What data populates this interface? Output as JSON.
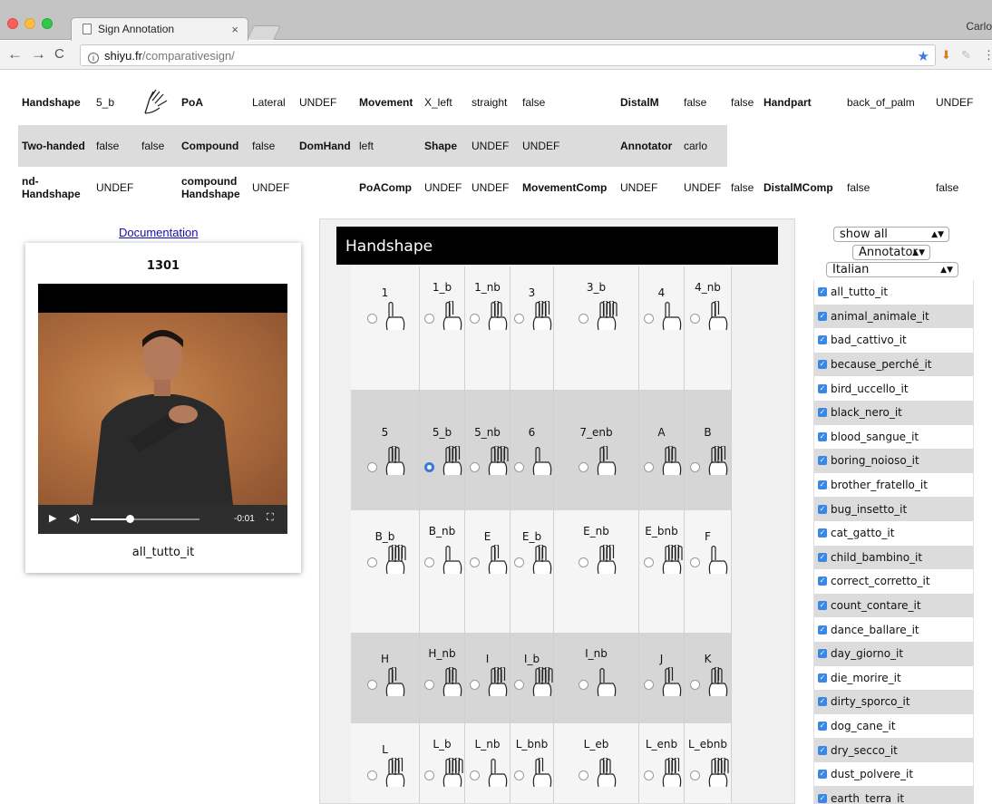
{
  "browser": {
    "tab_title": "Sign Annotation",
    "tab_close": "×",
    "url_host": "shiyu.fr",
    "url_path": "/comparativesign/",
    "profile": "Carlo"
  },
  "attributes": {
    "row1": [
      "Handshape",
      "5_b",
      "",
      "PoA",
      "Lateral",
      "UNDEF",
      "Movement",
      "X_left",
      "straight",
      "false",
      "DistalM",
      "false",
      "false",
      "Handpart",
      "back_of_palm",
      "UNDEF"
    ],
    "row2": [
      "Two-handed",
      "false",
      "false",
      "Compound",
      "false",
      "DomHand",
      "left",
      "Shape",
      "UNDEF",
      "UNDEF",
      "Annotator",
      "carlo"
    ],
    "row3": [
      "nd-Handshape",
      "UNDEF",
      "",
      "compound Handshape",
      "UNDEF",
      "",
      "PoAComp",
      "UNDEF",
      "UNDEF",
      "MovementComp",
      "UNDEF",
      "UNDEF",
      "false",
      "DistalMComp",
      "false",
      "false"
    ]
  },
  "video": {
    "documentation_link": "Documentation",
    "number": "1301",
    "time": "-0:01",
    "progress": 0.36,
    "caption": "all_tutto_it"
  },
  "handshape": {
    "title": "Handshape",
    "selected": "5_b",
    "rows": [
      [
        "1",
        "1_b",
        "1_nb",
        "3",
        "3_b",
        "4",
        "4_nb"
      ],
      [
        "5",
        "5_b",
        "5_nb",
        "6",
        "7_enb",
        "A",
        "B"
      ],
      [
        "B_b",
        "B_nb",
        "E",
        "E_b",
        "E_nb",
        "E_bnb",
        "F"
      ],
      [
        "H",
        "H_nb",
        "I",
        "I_b",
        "I_nb",
        "J",
        "K"
      ],
      [
        "L",
        "L_b",
        "L_nb",
        "L_bnb",
        "L_eb",
        "L_enb",
        "L_ebnb"
      ]
    ]
  },
  "filters": {
    "show": "show all",
    "annotator": "Annotator",
    "language": "Italian"
  },
  "signs": [
    "all_tutto_it",
    "animal_animale_it",
    "bad_cattivo_it",
    "because_perché_it",
    "bird_uccello_it",
    "black_nero_it",
    "blood_sangue_it",
    "boring_noioso_it",
    "brother_fratello_it",
    "bug_insetto_it",
    "cat_gatto_it",
    "child_bambino_it",
    "correct_corretto_it",
    "count_contare_it",
    "dance_ballare_it",
    "day_giorno_it",
    "die_morire_it",
    "dirty_sporco_it",
    "dog_cane_it",
    "dry_secco_it",
    "dust_polvere_it",
    "earth_terra_it"
  ]
}
